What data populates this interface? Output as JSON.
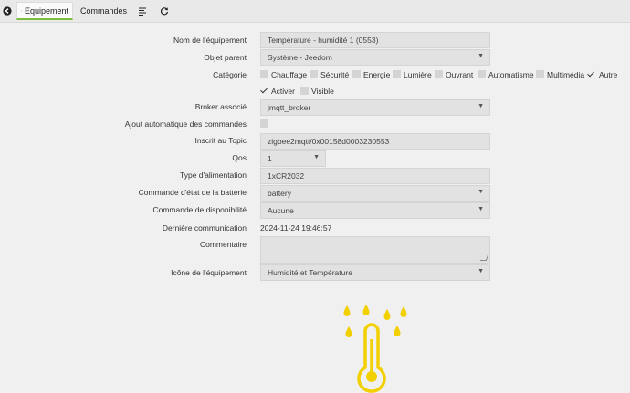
{
  "tabs": {
    "back_icon": "back-arrow-icon",
    "equipement": "Equipement",
    "commandes": "Commandes",
    "list_icon": "list-icon",
    "refresh_icon": "refresh-icon"
  },
  "form": {
    "nom_label": "Nom de l'équipement",
    "nom_value": "Température - humidité 1 (0553)",
    "parent_label": "Objet parent",
    "parent_value": "Système - Jeedom",
    "categorie_label": "Catégorie",
    "categories": [
      {
        "label": "Chauffage",
        "checked": false
      },
      {
        "label": "Sécurité",
        "checked": false
      },
      {
        "label": "Energie",
        "checked": false
      },
      {
        "label": "Lumière",
        "checked": false
      },
      {
        "label": "Ouvrant",
        "checked": false
      },
      {
        "label": "Automatisme",
        "checked": false
      },
      {
        "label": "Multimédia",
        "checked": false
      },
      {
        "label": "Autre",
        "checked": true
      }
    ],
    "activer_label": "Activer",
    "activer_checked": true,
    "visible_label": "Visible",
    "visible_checked": false,
    "broker_label": "Broker associé",
    "broker_value": "jmqtt_broker",
    "ajout_label": "Ajout automatique des commandes",
    "ajout_checked": false,
    "topic_label": "Inscrit au Topic",
    "topic_value": "zigbee2mqtt/0x00158d0003230553",
    "qos_label": "Qos",
    "qos_value": "1",
    "alim_label": "Type d'alimentation",
    "alim_value": "1xCR2032",
    "batterie_label": "Commande d'état de la batterie",
    "batterie_value": "battery",
    "dispo_label": "Commande de disponibilité",
    "dispo_value": "Aucune",
    "derniere_label": "Dernière communication",
    "derniere_value": "2024-11-24 19:46:57",
    "commentaire_label": "Commentaire",
    "commentaire_value": "",
    "icone_label": "Icône de l'équipement",
    "icone_value": "Humidité et Température"
  },
  "preview": {
    "icon": "humidity-temperature-icon",
    "color": "#f2d000"
  }
}
